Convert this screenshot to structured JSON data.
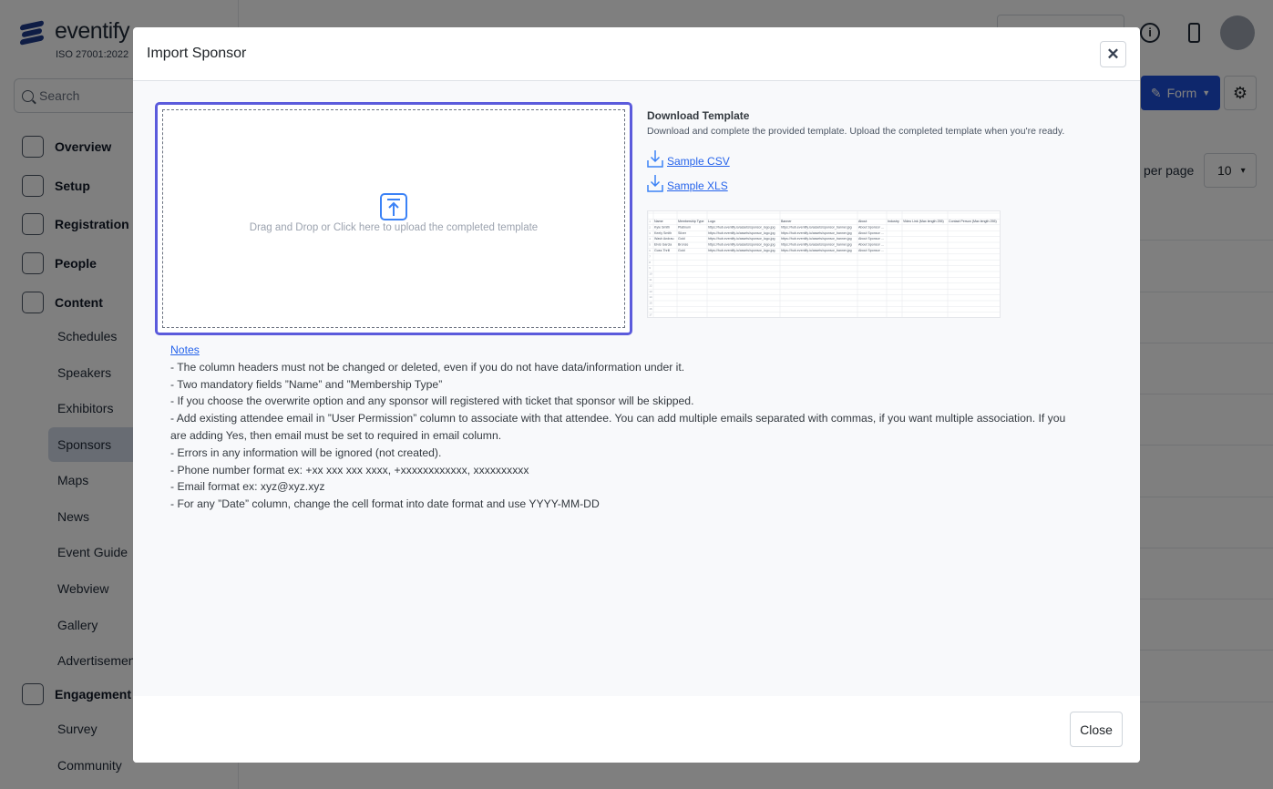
{
  "sidebar": {
    "brand": "eventify",
    "iso": "ISO 27001:2022",
    "search_placeholder": "Search",
    "sections": [
      {
        "label": "Overview",
        "icon": "home-icon"
      },
      {
        "label": "Setup",
        "icon": "layers-icon"
      },
      {
        "label": "Registration",
        "icon": "ticket-icon"
      },
      {
        "label": "People",
        "icon": "people-icon"
      },
      {
        "label": "Content",
        "icon": "content-icon"
      },
      {
        "label": "Engagement",
        "icon": "bolt-icon"
      }
    ],
    "content_items": [
      "Schedules",
      "Speakers",
      "Exhibitors",
      "Sponsors",
      "Maps",
      "News",
      "Event Guide",
      "Webview",
      "Gallery",
      "Advertisement"
    ],
    "engagement_items": [
      "Survey",
      "Community"
    ]
  },
  "toolbar": {
    "form_button": "Form",
    "per_page_label": "per page",
    "per_page_value": "10"
  },
  "modal": {
    "title": "Import Sponsor",
    "dropzone_text": "Drag and Drop or Click here to upload the completed template",
    "download_title": "Download Template",
    "download_desc": "Download and complete the provided template. Upload the completed template when you're ready.",
    "sample_csv": "Sample CSV",
    "sample_xls": "Sample XLS",
    "preview": {
      "headers": [
        "Name",
        "Membership Type",
        "Logo",
        "Banner",
        "About",
        "Industry",
        "Video Link (Max length 255)",
        "Contact Person (Max length 255)"
      ],
      "rows": [
        [
          "Kyle Smith",
          "Platinum",
          "https://hub.eventify.io/assets/sponsor_logo.jpg",
          "https://hub.eventify.io/assets/sponsor_banner.jpg",
          "About Sponsor ..."
        ],
        [
          "Keely Smith",
          "Silver",
          "https://hub.eventify.io/assets/sponsor_logo.jpg",
          "https://hub.eventify.io/assets/sponsor_banner.jpg",
          "About Sponsor ..."
        ],
        [
          "Wash Andrau",
          "Gold",
          "https://hub.eventify.io/assets/sponsor_logo.jpg",
          "https://hub.eventify.io/assets/sponsor_banner.jpg",
          "About Sponsor ..."
        ],
        [
          "Elvis Garcia",
          "Bronze",
          "https://hub.eventify.io/assets/sponsor_logo.jpg",
          "https://hub.eventify.io/assets/sponsor_banner.jpg",
          "About Sponsor ..."
        ],
        [
          "Guss Thrill",
          "Gold",
          "https://hub.eventify.io/assets/sponsor_logo.jpg",
          "https://hub.eventify.io/assets/sponsor_banner.jpg",
          "About Sponsor ..."
        ]
      ]
    },
    "notes_title": "Notes",
    "notes": [
      "- The column headers must not be changed or deleted, even if you do not have data/information under it.",
      "- Two mandatory fields ”Name” and ”Membership Type”",
      "- If you choose the overwrite option and any sponsor will registered with ticket that sponsor will be skipped.",
      "- Add existing attendee email in ”User Permission” column to associate with that attendee. You can add multiple emails separated with commas, if you want multiple association. If you are adding Yes, then email must be set to required in email column.",
      "- Errors in any information will be ignored (not created).",
      "- Phone number format ex: +xx xxx xxx xxxx, +xxxxxxxxxxxx, xxxxxxxxxx",
      "- Email format ex: xyz@xyz.xyz",
      "- For any ”Date” column, change the cell format into date format and use YYYY-MM-DD"
    ],
    "close_button": "Close"
  }
}
